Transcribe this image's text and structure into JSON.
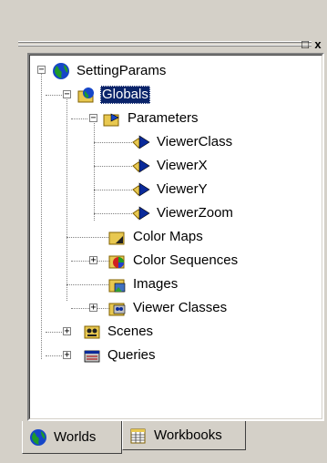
{
  "window": {
    "restore_label": "□",
    "close_label": "x"
  },
  "tree": {
    "nodes": [
      {
        "label": "SettingParams",
        "icon": "globe-icon"
      },
      {
        "label": "Globals",
        "icon": "folder-globe-icon",
        "selected": true
      },
      {
        "label": "Parameters",
        "icon": "folder-params-icon"
      },
      {
        "label": "ViewerClass",
        "icon": "arrow-param-icon"
      },
      {
        "label": "ViewerX",
        "icon": "arrow-param-icon"
      },
      {
        "label": "ViewerY",
        "icon": "arrow-param-icon"
      },
      {
        "label": "ViewerZoom",
        "icon": "arrow-param-icon"
      },
      {
        "label": "Color Maps",
        "icon": "folder-colormap-icon"
      },
      {
        "label": "Color Sequences",
        "icon": "folder-colorseq-icon"
      },
      {
        "label": "Images",
        "icon": "folder-images-icon"
      },
      {
        "label": "Viewer Classes",
        "icon": "folder-viewer-icon"
      },
      {
        "label": "Scenes",
        "icon": "scenes-icon"
      },
      {
        "label": "Queries",
        "icon": "queries-icon"
      }
    ]
  },
  "tabs": [
    {
      "label": "Worlds",
      "icon": "globe-icon",
      "active": true
    },
    {
      "label": "Workbooks",
      "icon": "workbook-icon",
      "active": false
    }
  ],
  "colors": {
    "selection": "#0a246a",
    "background": "#d4d0c8"
  }
}
